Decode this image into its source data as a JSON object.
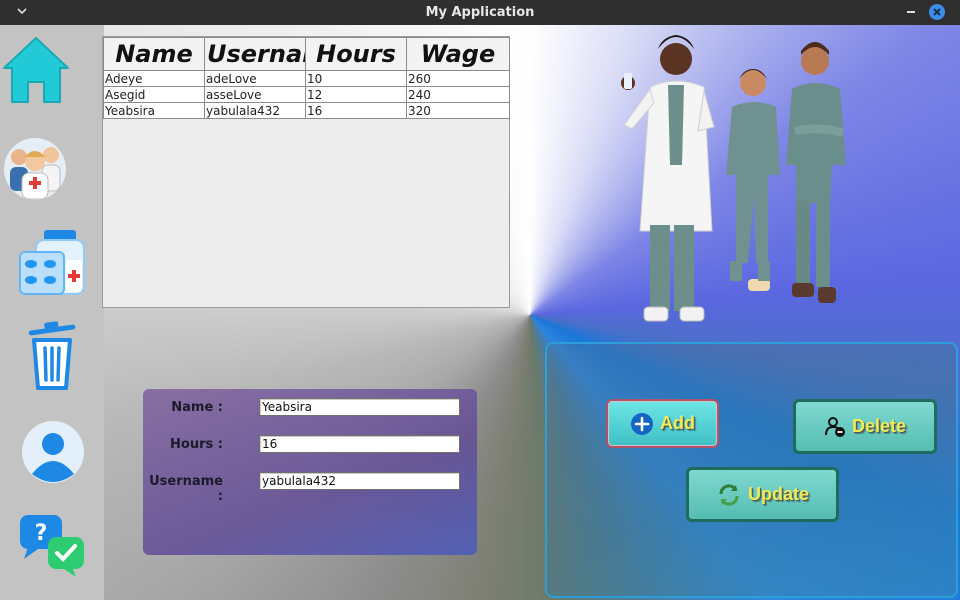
{
  "window": {
    "title": "My Application"
  },
  "sidebar": {
    "items": [
      {
        "icon": "home-icon"
      },
      {
        "icon": "staff-group-icon"
      },
      {
        "icon": "medicine-icon"
      },
      {
        "icon": "trash-icon"
      },
      {
        "icon": "user-profile-icon"
      },
      {
        "icon": "help-chat-icon"
      }
    ]
  },
  "table": {
    "headers": [
      "Name",
      "Username",
      "Hours",
      "Wage"
    ],
    "rows": [
      [
        "Adeye",
        "adeLove",
        "10",
        "260"
      ],
      [
        "Asegid",
        "asseLove",
        "12",
        "240"
      ],
      [
        "Yeabsira",
        "yabulala432",
        "16",
        "320"
      ]
    ]
  },
  "form": {
    "name_label": "Name :",
    "name_value": "Yeabsira",
    "hours_label": "Hours :",
    "hours_value": "16",
    "username_label": "Username :",
    "username_value": "yabulala432"
  },
  "actions": {
    "add_label": "Add",
    "delete_label": "Delete",
    "update_label": "Update"
  },
  "colors": {
    "accent": "#2e9ed8",
    "button_text": "#f0ec58",
    "sidebar_bg": "#c3c3c3"
  }
}
